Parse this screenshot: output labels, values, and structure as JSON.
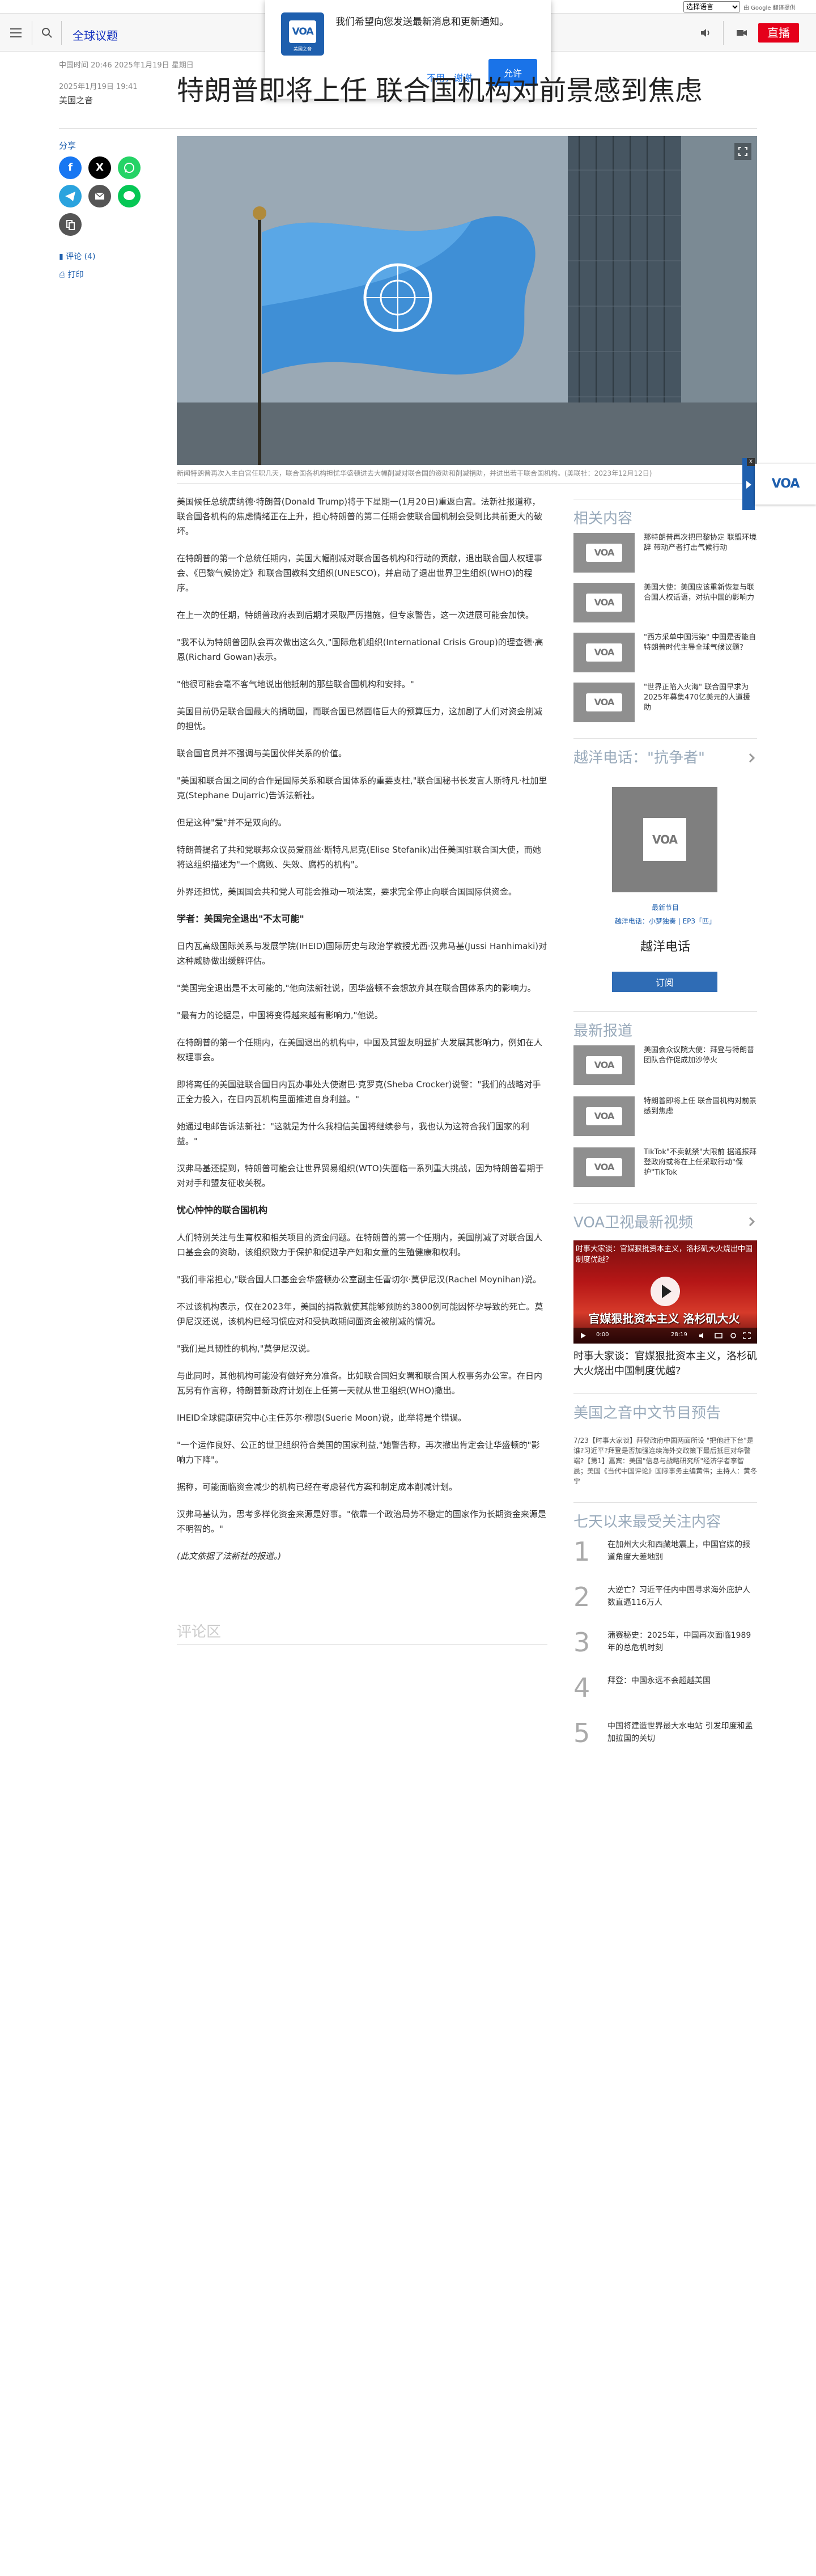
{
  "util_bar": {
    "language_select": "选择语言",
    "google_note": "由 Google 翻译提供"
  },
  "header": {
    "site_title": "全球议题",
    "live_label": "直播"
  },
  "notification": {
    "message": "我们希望向您发送最新消息和更新通知。",
    "logo_text": "VOA",
    "logo_sub": "美国之音",
    "deny_label": "不用，谢谢",
    "allow_label": "允许"
  },
  "article": {
    "local_time": "中国时间 20:46 2025年1月19日 星期日",
    "date": "2025年1月19日 19:41",
    "source": "美国之音",
    "headline": "特朗普即将上任 联合国机构对前景感到焦虑",
    "share_label": "分享",
    "comments_label": "评论 (4)",
    "print_label": "打印",
    "caption": "新闻特朗普再次入主白宫任职几天，联合国各机构担忧华盛顿进去大幅削减对联合国的资助和削减捐助，并进出若干联合国机构。(美联社：2023年12月12日)",
    "paragraphs": [
      "美国候任总统唐纳德·特朗普(Donald Trump)将于下星期一(1月20日)重返白宫。法新社报道称，联合国各机构的焦虑情绪正在上升，担心特朗普的第二任期会使联合国机制会受到比共前更大的破坏。",
      "在特朗普的第一个总统任期内，美国大幅削减对联合国各机构和行动的贡献，退出联合国人权理事会、《巴黎气候协定》和联合国教科文组织(UNESCO)，并启动了退出世界卫生组织(WHO)的程序。",
      "在上一次的任期，特朗普政府表到后期才采取严厉措施，但专家警告，这一次进展可能会加快。",
      "\"我不认为特朗普团队会再次做出这么久,\"国际危机组织(International Crisis Group)的理查德·高恩(Richard Gowan)表示。",
      "\"他很可能会毫不客气地说出他抵制的那些联合国机构和安排。\"",
      "美国目前仍是联合国最大的捐助国，而联合国已然面临巨大的预算压力，这加剧了人们对资金削减的担忧。",
      "联合国官员并不强调与美国伙伴关系的价值。",
      "\"美国和联合国之间的合作是国际关系和联合国体系的重要支柱,\"联合国秘书长发言人斯特凡·杜加里克(Stephane Dujarric)告诉法新社。",
      "但是这种\"爱\"并不是双向的。",
      "特朗普提名了共和党联邦众议员爱丽丝·斯特凡尼克(Elise Stefanik)出任美国驻联合国大使，而她将这组织描述为\"一个腐败、失效、腐朽的机构\"。",
      "外界还担忧，美国国会共和党人可能会推动一项法案，要求完全停止向联合国国际供资金。"
    ],
    "subhead_1": "学者：美国完全退出\"不太可能\"",
    "paragraphs_2": [
      "日内瓦高级国际关系与发展学院(IHEID)国际历史与政治学教授尤西·汉弗马基(Jussi Hanhimaki)对这种威胁做出缓解评估。",
      "\"美国完全退出是不太可能的,\"他向法新社说，因华盛顿不会想放弃其在联合国体系内的影响力。",
      "\"最有力的论据是，中国将变得越来越有影响力,\"他说。",
      "在特朗普的第一个任期内，在美国退出的机构中，中国及其盟友明显扩大发展其影响力，例如在人权理事会。",
      "即将离任的美国驻联合国日内瓦办事处大使谢巴·克罗克(Sheba Crocker)说警：\"我们的战略对手正全力投入，在日内瓦机构里面推进自身利益。\"",
      "她通过电邮告诉法新社：\"这就是为什么我相信美国将继续参与，我也认为这符合我们国家的利益。\"",
      "汉弗马基还提到，特朗普可能会让世界贸易组织(WTO)失面临一系列重大挑战，因为特朗普看期于对对手和盟友征收关税。"
    ],
    "subhead_2": "忧心忡忡的联合国机构",
    "paragraphs_3": [
      "人们特别关注与生育权和相关项目的资金问题。在特朗普的第一个任期内，美国削减了对联合国人口基金会的资助，该组织致力于保护和促进孕产妇和女童的生殖健康和权利。",
      "\"我们非常担心,\"联合国人口基金会华盛顿办公室副主任雷切尔·莫伊尼汉(Rachel Moynihan)说。",
      "不过该机构表示，仅在2023年，美国的捐款就使其能够预防约3800例可能因怀孕导致的死亡。莫伊尼汉还说，该机构已经习惯应对和受执政期间面资金被削减的情况。",
      "\"我们是具韧性的机构,\"莫伊尼汉说。",
      "与此同时，其他机构可能没有做好充分准备。比如联合国妇女署和联合国人权事务办公室。在日内瓦另有作言称，特朗普新政府计划在上任第一天就从世卫组织(WHO)撤出。",
      "IHEID全球健康研究中心主任苏尔·穆恩(Suerie Moon)说，此举将是个错误。",
      "\"一个运作良好、公正的世卫组织符合美国的国家利益,\"她警告称，再次撤出肯定会让华盛顿的\"影响力下降\"。",
      "据称，可能面临资金减少的机构已经在考虑替代方案和制定成本削减计划。",
      "汉弗马基认为，思考多样化资金来源是好事。\"依靠一个政治局势不稳定的国家作为长期资金来源是不明智的。\""
    ],
    "closing_note": "(此文依据了法新社的报道。)",
    "comment_area_title": "评论区"
  },
  "sidebar": {
    "related_title": "相关内容",
    "related": [
      {
        "title": "那特朗普再次把巴黎协定 联盟环境辞 带动产者打击气候行动"
      },
      {
        "title": "美国大使：美国应该重新恢复与联合国人权话语，对抗中国的影响力"
      },
      {
        "title": "\"西方采单中国污染\" 中国是否能自特朗普时代主导全球气候议题？"
      },
      {
        "title": "\"世界正陷入火海\" 联合国早求为2025年募集470亿美元的人道援助"
      }
    ],
    "podcast_section_title": "越洋电话：\"抗争者\"",
    "podcast_latest": "最新节目",
    "podcast_series": "越洋电话：小梦独奏 | EP3「匹」",
    "podcast_name": "越洋电话",
    "podcast_subscribe": "订阅",
    "latest_title": "最新报道",
    "latest": [
      {
        "title": "美国会众议院大使：拜登与特朗普团队合作促成加沙停火"
      },
      {
        "title": "特朗普即将上任 联合国机构对前景感到焦虑"
      },
      {
        "title": "TikTok\"不卖就禁\"大限前 据通报拜登政府或将在上任采取行动\"保护\"TikTok"
      }
    ],
    "video_title_section": "VOA卫视最新视频",
    "video_overlay_top": "时事大家谈：官媒狠批资本主义，洛杉矶大火烧出中国制度优越？",
    "video_banner": "官媒狠批资本主义 洛杉矶大火",
    "video_time": "0:00",
    "video_duration": "28:19",
    "video_title": "时事大家谈：官媒狠批资本主义，洛杉矶大火烧出中国制度优越?",
    "preview_title": "美国之音中文节目预告",
    "preview_text": "7/23【时事大家谈】拜登政府中国两面所设 \"把他赶下台\"是谁?习近平?拜登是否加强连续海外交政策下最后抵巨对华警端?【第1】嘉宾：美国\"信息与战略研究所\"经济学者李智晨；美国《当代中国评论》国际事务主编黄伟；主持人：黄冬宁",
    "ranking_title": "七天以来最受关注内容",
    "ranking": [
      {
        "n": "1",
        "title": "在加州大火和西藏地震上，中国官媒的报道角度大差地别"
      },
      {
        "n": "2",
        "title": "大逆亡？习近平任内中国寻求海外庇护人数直逼116万人"
      },
      {
        "n": "3",
        "title": "蒲赛秘史：2025年，中国再次面临1989年的总危机时刻"
      },
      {
        "n": "4",
        "title": "拜登：中国永远不会超越美国"
      },
      {
        "n": "5",
        "title": "中国将建造世界最大水电站 引发印度和孟加拉国的关切"
      }
    ]
  },
  "float_widget": {
    "logo_text": "VOA",
    "close_label": "X"
  },
  "colors": {
    "brand_blue": "#1e5fae",
    "live_red": "#e5001a"
  },
  "icons": {
    "menu": "hamburger-icon",
    "search": "search-icon",
    "speaker": "speaker-icon",
    "video": "video-camera-icon",
    "expand": "expand-icon",
    "facebook": "facebook-icon",
    "x": "x-icon",
    "whatsapp": "whatsapp-icon",
    "telegram": "telegram-icon",
    "email": "email-icon",
    "line": "line-icon",
    "copy": "copy-link-icon",
    "comment": "comment-icon",
    "print": "print-icon"
  }
}
